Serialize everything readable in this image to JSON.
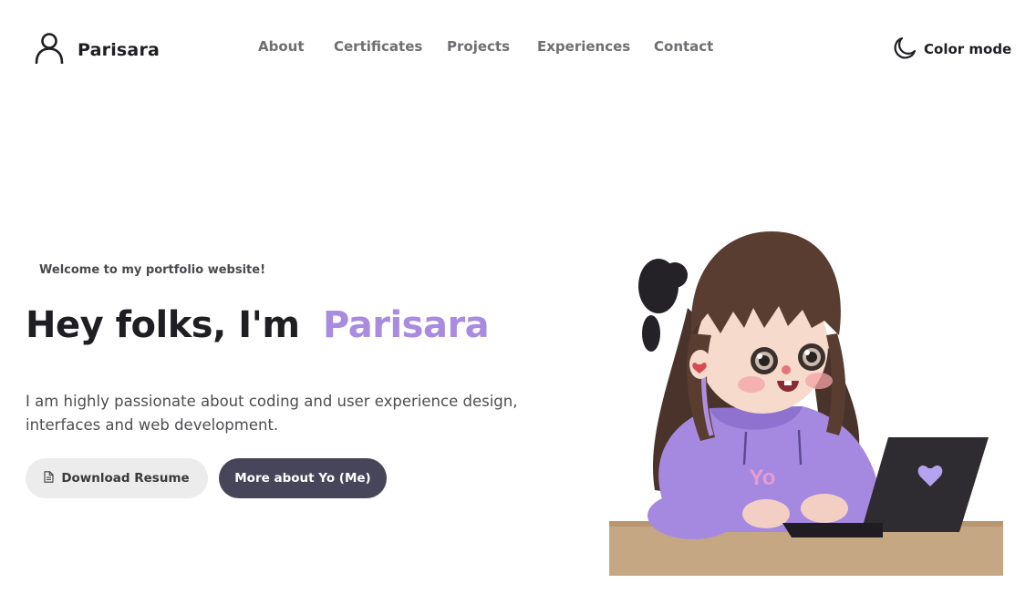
{
  "header": {
    "brand_name": "Parisara",
    "nav": [
      {
        "label": "About"
      },
      {
        "label": "Certificates"
      },
      {
        "label": "Projects"
      },
      {
        "label": "Experiences"
      },
      {
        "label": "Contact"
      }
    ],
    "color_mode_label": "Color mode"
  },
  "hero": {
    "welcome": "Welcome to my portfolio website!",
    "headline_prefix": "Hey folks, I'm",
    "headline_name": "Parisara",
    "intro": "I am highly passionate about coding and user experience design, interfaces and web development.",
    "buttons": {
      "resume": "Download Resume",
      "more": "More about Yo (Me)"
    },
    "illustration": {
      "hoodie_text": "Yo"
    }
  },
  "colors": {
    "accent": "#a98be0",
    "primary_button": "#474559",
    "secondary_button": "#ececec",
    "nav_text": "#6f6f73",
    "text_dark": "#1f1f23"
  },
  "icons": {
    "brand": "user-icon",
    "color_mode": "moon-icon",
    "resume": "document-icon"
  }
}
